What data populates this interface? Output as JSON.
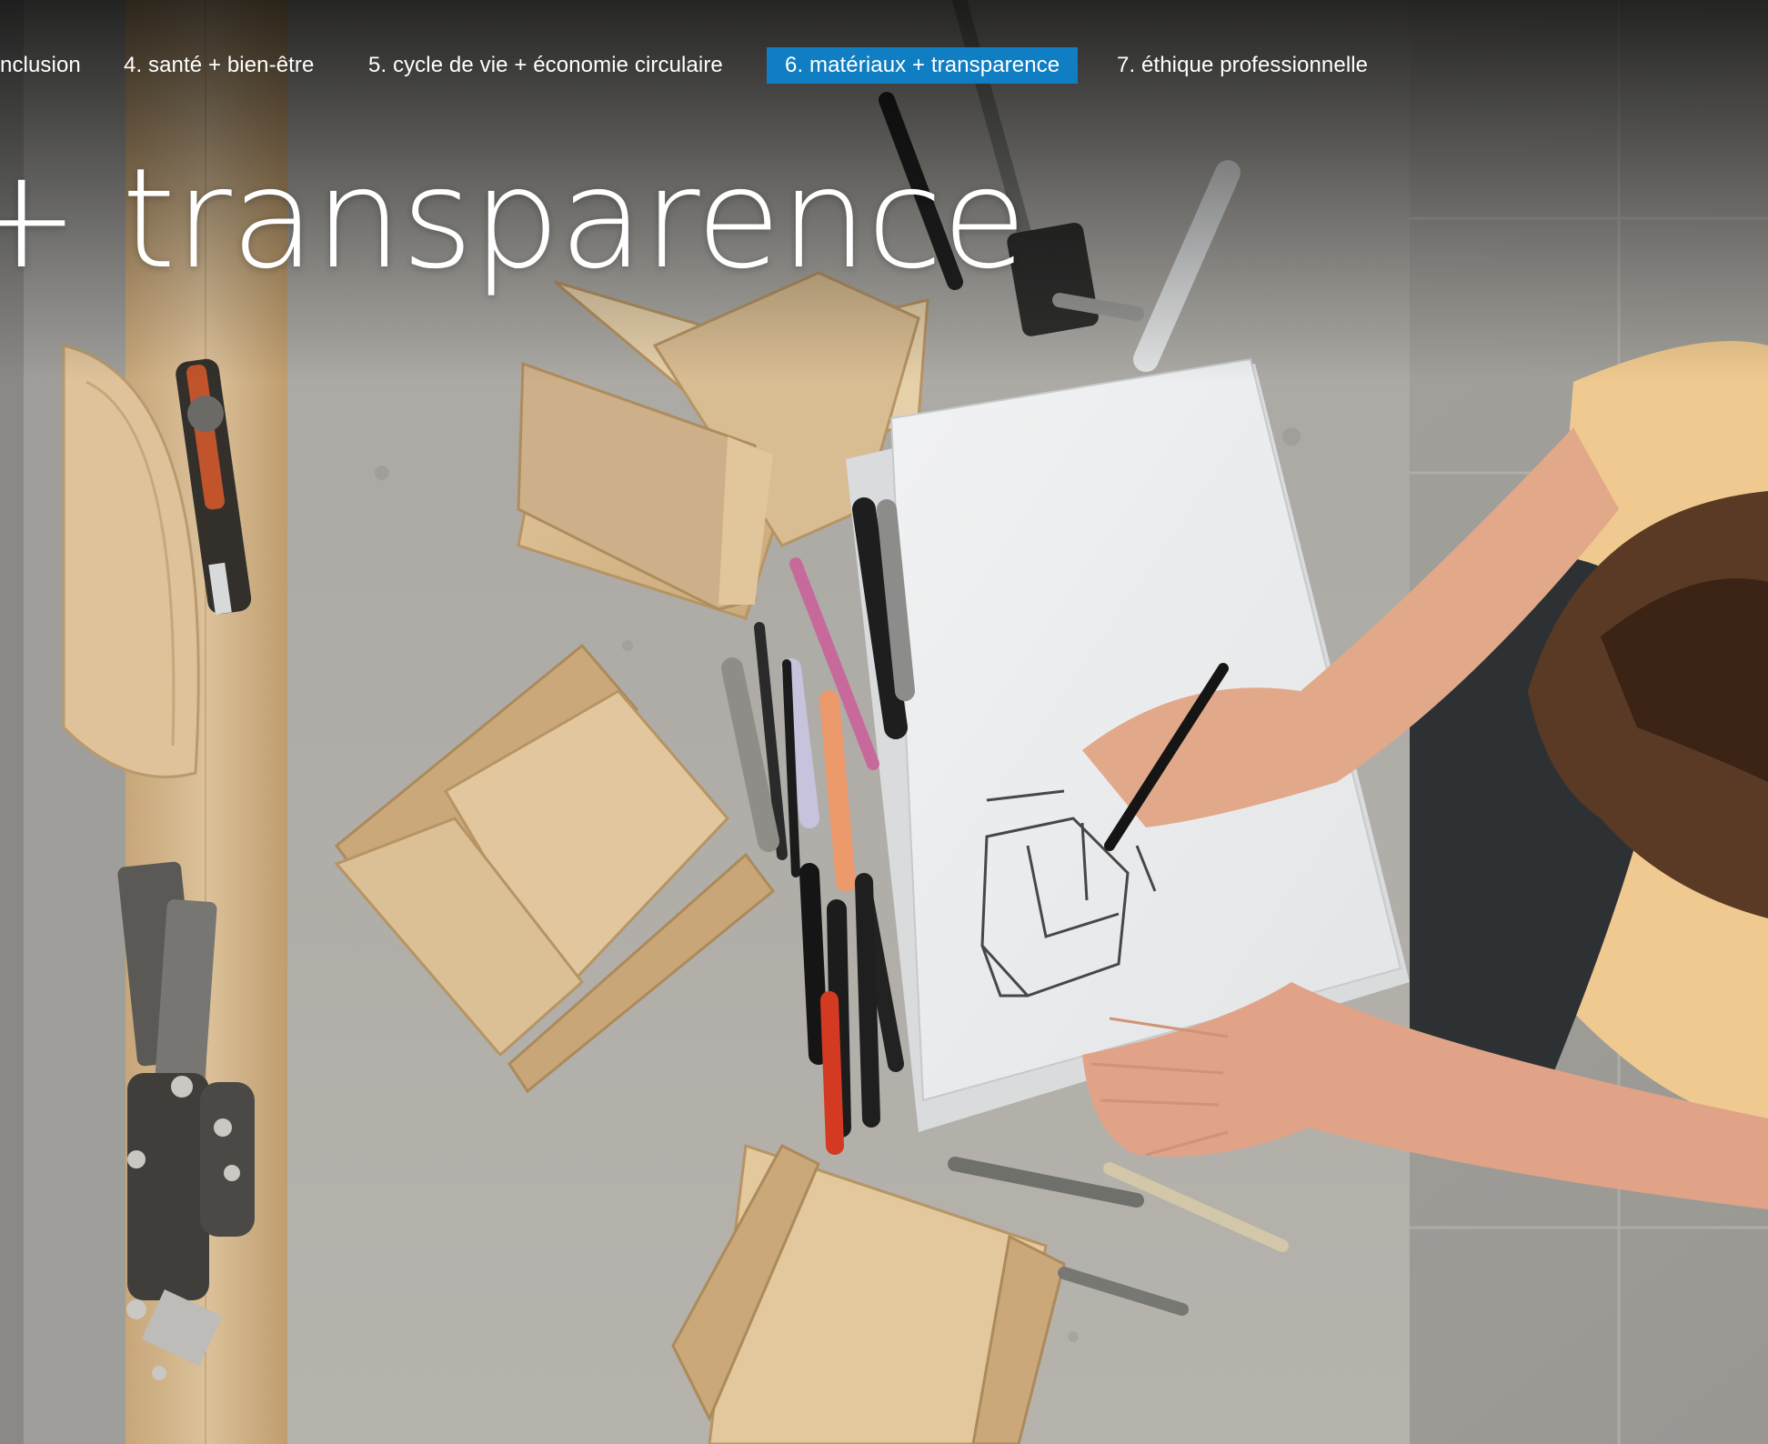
{
  "nav": {
    "items": [
      {
        "label": "nclusion",
        "active": false
      },
      {
        "label": "4. santé + bien-être",
        "active": false
      },
      {
        "label": "5. cycle de vie + économie circulaire",
        "active": false
      },
      {
        "label": "6. matériaux + transparence",
        "active": true
      },
      {
        "label": "7. éthique professionnelle",
        "active": false
      }
    ],
    "active_color": "#0f7ec3"
  },
  "hero": {
    "title": "+ transparence",
    "image_description_icon": "workshop-photo"
  }
}
